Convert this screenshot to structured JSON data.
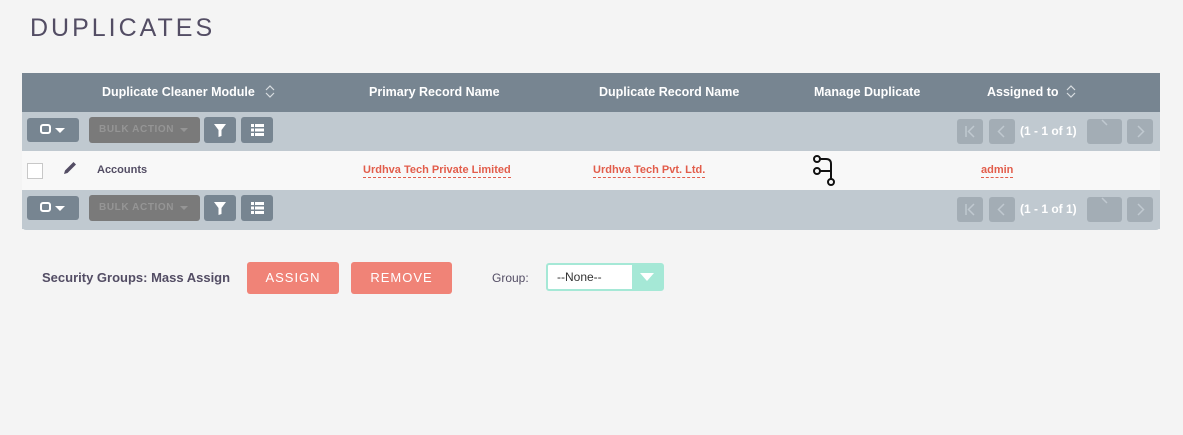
{
  "page": {
    "title": "DUPLICATES"
  },
  "table": {
    "columns": [
      {
        "label": "Duplicate Cleaner Module",
        "sortable": true
      },
      {
        "label": "Primary Record Name",
        "sortable": false
      },
      {
        "label": "Duplicate Record Name",
        "sortable": false
      },
      {
        "label": "Manage Duplicate",
        "sortable": false
      },
      {
        "label": "Assigned to",
        "sortable": true
      }
    ],
    "rows": [
      {
        "module": "Accounts",
        "primary_record": "Urdhva Tech Private Limited",
        "duplicate_record": "Urdhva Tech Pvt. Ltd.",
        "manage_icon": "merge-icon",
        "assigned_to": "admin"
      }
    ]
  },
  "toolbar": {
    "bulk_action_label": "BULK ACTION",
    "pagination_text": "(1 - 1 of 1)"
  },
  "security_groups": {
    "label": "Security Groups: Mass Assign",
    "assign_label": "ASSIGN",
    "remove_label": "REMOVE",
    "group_label": "Group:",
    "group_value": "--None--"
  },
  "colors": {
    "header_bg": "#778591",
    "toolbar_bg": "#c0c9d0",
    "link": "#e25d4b",
    "button_red": "#f08377",
    "select_accent": "#a5e8d6"
  }
}
